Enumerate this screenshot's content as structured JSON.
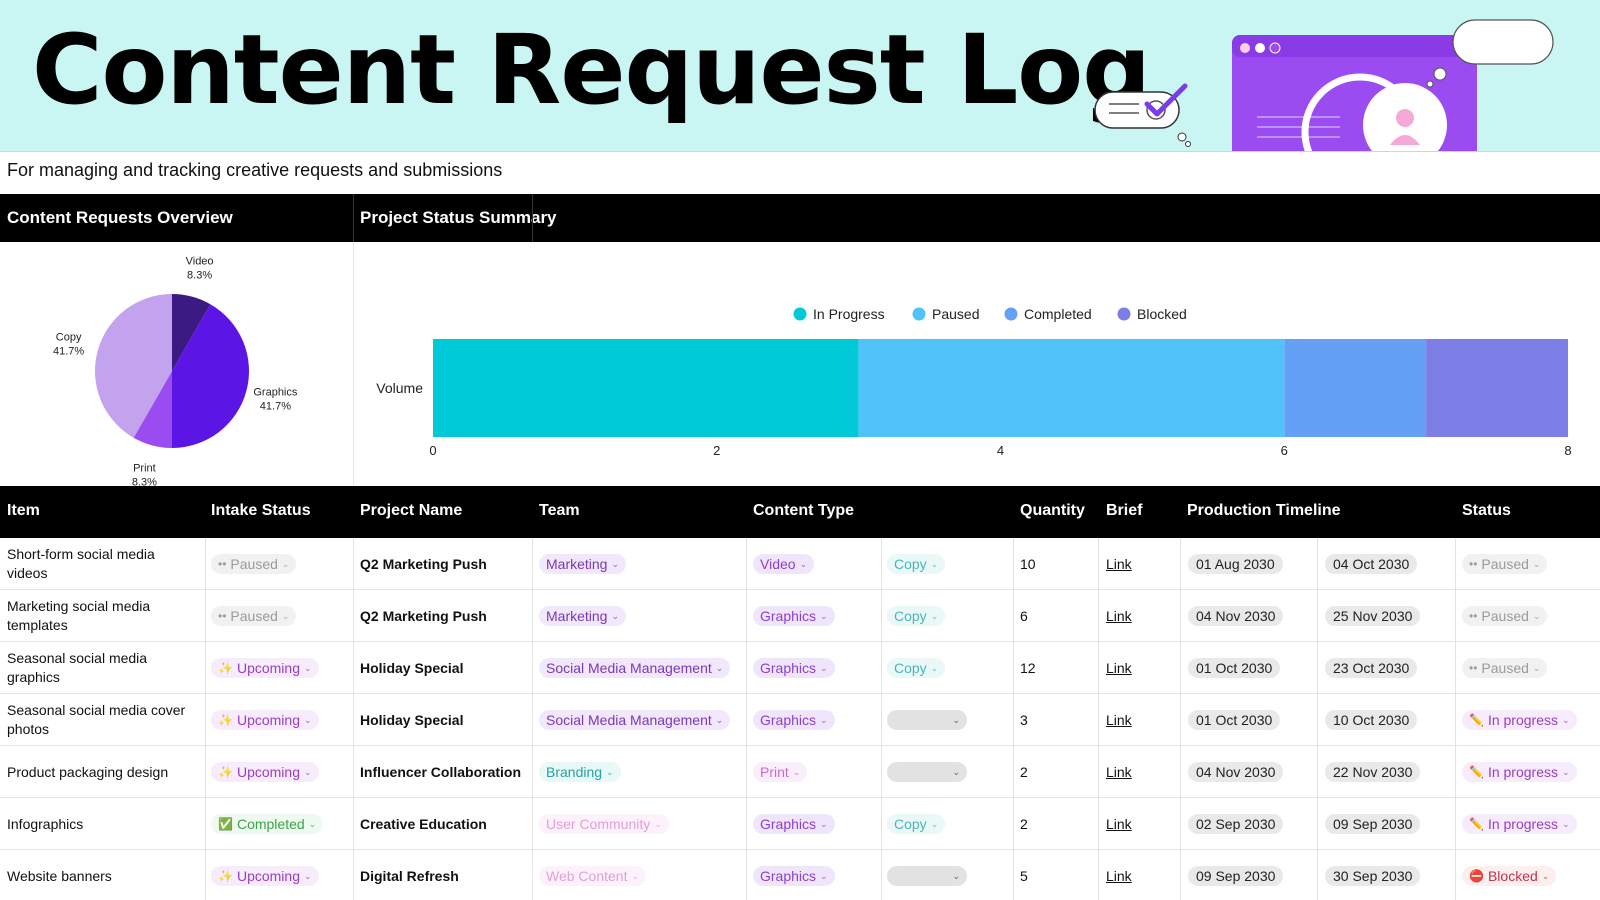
{
  "header": {
    "title": "Content Request Log",
    "subtitle": "For managing and tracking creative requests and submissions"
  },
  "sections": {
    "overview": "Content Requests Overview",
    "summary": "Project Status Summary"
  },
  "colors": {
    "banner_bg": "#c9f6f2",
    "pie_video": "#3b1a82",
    "pie_graphics": "#5b16e6",
    "pie_print": "#9b4cf0",
    "pie_copy": "#c4a3ee",
    "in_progress": "#00c9d8",
    "paused": "#4fc3fa",
    "completed": "#64a0f6",
    "blocked": "#7d7de6"
  },
  "chart_data": [
    {
      "type": "pie",
      "title": "",
      "slices": [
        {
          "label": "Video",
          "value": 8.3,
          "display": "8.3%"
        },
        {
          "label": "Graphics",
          "value": 41.7,
          "display": "41.7%"
        },
        {
          "label": "Print",
          "value": 8.3,
          "display": "8.3%"
        },
        {
          "label": "Copy",
          "value": 41.7,
          "display": "41.7%"
        }
      ]
    },
    {
      "type": "bar",
      "orientation": "horizontal-stacked",
      "categories": [
        "Volume"
      ],
      "series": [
        {
          "name": "In Progress",
          "values": [
            3
          ]
        },
        {
          "name": "Paused",
          "values": [
            3
          ]
        },
        {
          "name": "Completed",
          "values": [
            1
          ]
        },
        {
          "name": "Blocked",
          "values": [
            1
          ]
        }
      ],
      "xlim": [
        0,
        8
      ],
      "xticks": [
        "0",
        "2",
        "4",
        "6",
        "8"
      ],
      "legend": "top",
      "grid": false
    }
  ],
  "table": {
    "headers": [
      "Item",
      "Intake Status",
      "Project Name",
      "Team",
      "Content Type",
      "Quantity",
      "Brief",
      "Production Timeline",
      "Status"
    ],
    "rows": [
      {
        "item": "Short-form social media videos",
        "intake": "Paused",
        "intake_kind": "paused",
        "project": "Q2 Marketing Push",
        "team": "Marketing",
        "team_kind": "purple",
        "ct1": "Video",
        "ct1_kind": "purple",
        "ct2": "Copy",
        "qty": "10",
        "brief": "Link",
        "start": "01 Aug 2030",
        "end": "04 Oct 2030",
        "status": "Paused",
        "status_kind": "paused"
      },
      {
        "item": "Marketing social media templates",
        "intake": "Paused",
        "intake_kind": "paused",
        "project": "Q2 Marketing Push",
        "team": "Marketing",
        "team_kind": "purple",
        "ct1": "Graphics",
        "ct1_kind": "purple",
        "ct2": "Copy",
        "qty": "6",
        "brief": "Link",
        "start": "04 Nov 2030",
        "end": "25 Nov 2030",
        "status": "Paused",
        "status_kind": "paused"
      },
      {
        "item": "Seasonal social media graphics",
        "intake": "Upcoming",
        "intake_kind": "upcoming",
        "project": "Holiday Special",
        "team": "Social Media Management",
        "team_kind": "purple",
        "ct1": "Graphics",
        "ct1_kind": "purple",
        "ct2": "Copy",
        "qty": "12",
        "brief": "Link",
        "start": "01 Oct 2030",
        "end": "23 Oct 2030",
        "status": "Paused",
        "status_kind": "paused"
      },
      {
        "item": "Seasonal social media cover photos",
        "intake": "Upcoming",
        "intake_kind": "upcoming",
        "project": "Holiday Special",
        "team": "Social Media Management",
        "team_kind": "purple",
        "ct1": "Graphics",
        "ct1_kind": "purple",
        "ct2": "",
        "qty": "3",
        "brief": "Link",
        "start": "01 Oct 2030",
        "end": "10 Oct 2030",
        "status": "In progress",
        "status_kind": "inprog"
      },
      {
        "item": "Product packaging design",
        "intake": "Upcoming",
        "intake_kind": "upcoming",
        "project": "Influencer Collaboration",
        "team": "Branding",
        "team_kind": "teal",
        "ct1": "Print",
        "ct1_kind": "pink",
        "ct2": "",
        "qty": "2",
        "brief": "Link",
        "start": "04 Nov 2030",
        "end": "22 Nov 2030",
        "status": "In progress",
        "status_kind": "inprog"
      },
      {
        "item": "Infographics",
        "intake": "Completed",
        "intake_kind": "completed",
        "project": "Creative Education",
        "team": "User Community",
        "team_kind": "ltpink",
        "ct1": "Graphics",
        "ct1_kind": "purple",
        "ct2": "Copy",
        "qty": "2",
        "brief": "Link",
        "start": "02 Sep 2030",
        "end": "09 Sep 2030",
        "status": "In progress",
        "status_kind": "inprog"
      },
      {
        "item": "Website banners",
        "intake": "Upcoming",
        "intake_kind": "upcoming",
        "project": "Digital Refresh",
        "team": "Web Content",
        "team_kind": "ltpink",
        "ct1": "Graphics",
        "ct1_kind": "purple",
        "ct2": "",
        "qty": "5",
        "brief": "Link",
        "start": "09 Sep 2030",
        "end": "30 Sep 2030",
        "status": "Blocked",
        "status_kind": "blocked"
      }
    ]
  }
}
